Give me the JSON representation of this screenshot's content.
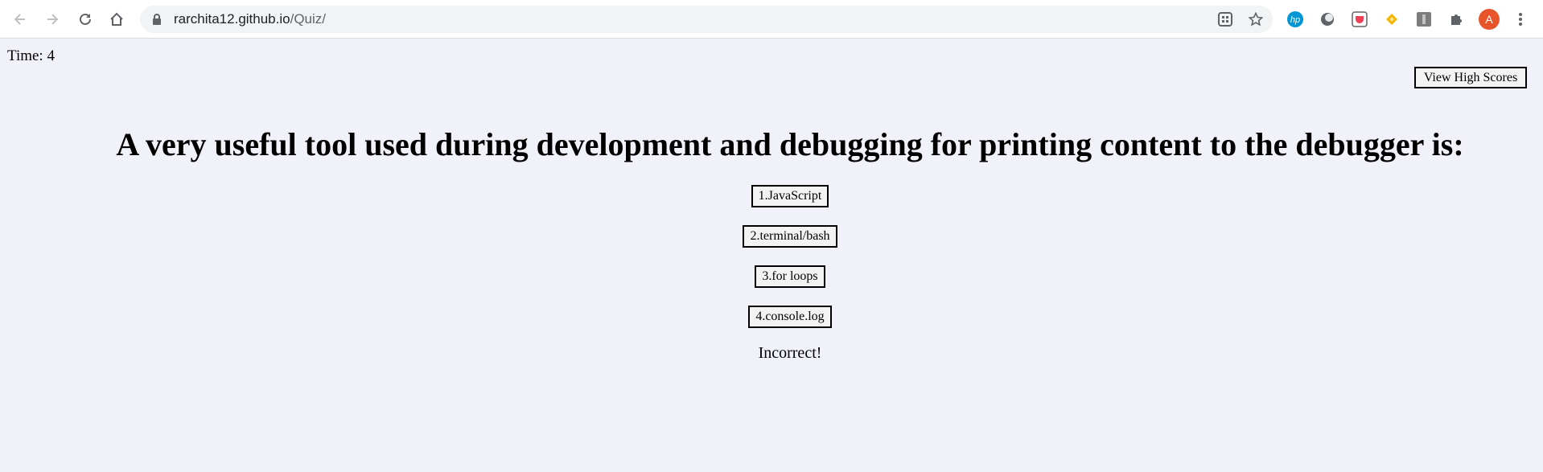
{
  "browser": {
    "url_host": "rarchita12.github.io",
    "url_path": "/Quiz/",
    "avatar_letter": "A",
    "icons": [
      "back-arrow-icon",
      "forward-arrow-icon",
      "reload-icon",
      "home-icon",
      "lock-icon",
      "qr-grid-icon",
      "star-icon",
      "hp-extension-icon",
      "circle-extension-icon",
      "pocket-extension-icon",
      "diamond-extension-icon",
      "image-extension-icon",
      "puzzle-icon",
      "kebab-menu-icon"
    ],
    "colors": {
      "avatar": "#e8552a",
      "hp": "#0096d6",
      "pocket": "#ef4056",
      "diamond": "#f4b400"
    }
  },
  "quiz": {
    "timer_label": "Time: 4",
    "high_scores_label": "View High Scores",
    "question": "A very useful tool used during development and debugging for printing content to the debugger is:",
    "answers": [
      {
        "label": "1.JavaScript"
      },
      {
        "label": "2.terminal/bash"
      },
      {
        "label": "3.for loops"
      },
      {
        "label": "4.console.log"
      }
    ],
    "feedback": "Incorrect!"
  },
  "colors": {
    "page_background": "#f1f1f9",
    "button_background": "#f3f3f3"
  }
}
